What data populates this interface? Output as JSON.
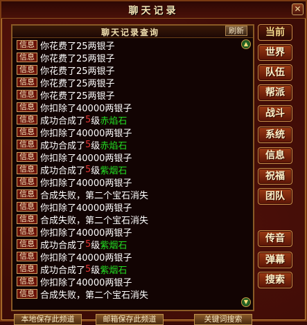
{
  "window": {
    "title": "聊天记录",
    "close_label": "✕"
  },
  "panel": {
    "title": "聊天记录查询",
    "refresh_label": "刷新"
  },
  "tag_label": "信息",
  "log": [
    {
      "segments": [
        {
          "t": "你花费了25两银子",
          "c": ""
        }
      ]
    },
    {
      "segments": [
        {
          "t": "你花费了25两银子",
          "c": ""
        }
      ]
    },
    {
      "segments": [
        {
          "t": "你花费了25两银子",
          "c": ""
        }
      ]
    },
    {
      "segments": [
        {
          "t": "你花费了25两银子",
          "c": ""
        }
      ]
    },
    {
      "segments": [
        {
          "t": "你花费了25两银子",
          "c": ""
        }
      ]
    },
    {
      "segments": [
        {
          "t": "你扣除了40000两银子",
          "c": ""
        }
      ]
    },
    {
      "segments": [
        {
          "t": "成功合成了",
          "c": ""
        },
        {
          "t": "5",
          "c": "lv"
        },
        {
          "t": "级",
          "c": ""
        },
        {
          "t": "赤焰石",
          "c": "item"
        }
      ]
    },
    {
      "segments": [
        {
          "t": "你扣除了40000两银子",
          "c": ""
        }
      ]
    },
    {
      "segments": [
        {
          "t": "成功合成了",
          "c": ""
        },
        {
          "t": "5",
          "c": "lv"
        },
        {
          "t": "级",
          "c": ""
        },
        {
          "t": "赤焰石",
          "c": "item"
        }
      ]
    },
    {
      "segments": [
        {
          "t": "你扣除了40000两银子",
          "c": ""
        }
      ]
    },
    {
      "segments": [
        {
          "t": "成功合成了",
          "c": ""
        },
        {
          "t": "5",
          "c": "lv"
        },
        {
          "t": "级",
          "c": ""
        },
        {
          "t": "紫烟石",
          "c": "item"
        }
      ]
    },
    {
      "segments": [
        {
          "t": "你扣除了40000两银子",
          "c": ""
        }
      ]
    },
    {
      "segments": [
        {
          "t": "合成失败，第二个宝石消失",
          "c": ""
        }
      ]
    },
    {
      "segments": [
        {
          "t": "你扣除了40000两银子",
          "c": ""
        }
      ]
    },
    {
      "segments": [
        {
          "t": "合成失败，第二个宝石消失",
          "c": ""
        }
      ]
    },
    {
      "segments": [
        {
          "t": "你扣除了40000两银子",
          "c": ""
        }
      ]
    },
    {
      "segments": [
        {
          "t": "成功合成了",
          "c": ""
        },
        {
          "t": "5",
          "c": "lv"
        },
        {
          "t": "级",
          "c": ""
        },
        {
          "t": "紫烟石",
          "c": "item"
        }
      ]
    },
    {
      "segments": [
        {
          "t": "你扣除了40000两银子",
          "c": ""
        }
      ]
    },
    {
      "segments": [
        {
          "t": "成功合成了",
          "c": ""
        },
        {
          "t": "5",
          "c": "lv"
        },
        {
          "t": "级",
          "c": ""
        },
        {
          "t": "紫烟石",
          "c": "item"
        }
      ]
    },
    {
      "segments": [
        {
          "t": "你扣除了40000两银子",
          "c": ""
        }
      ]
    },
    {
      "segments": [
        {
          "t": "合成失败，第二个宝石消失",
          "c": ""
        }
      ]
    }
  ],
  "channels": {
    "current": "当前",
    "world": "世界",
    "team": "队伍",
    "guild": "帮派",
    "battle": "战斗",
    "system": "系统",
    "info": "信息",
    "blessing": "祝福",
    "group": "团队",
    "voice": "传音",
    "danmaku": "弹幕",
    "search": "搜索"
  },
  "bottom": {
    "save_local": "本地保存此频道",
    "save_mail": "邮箱保存此频道",
    "keyword_search": "关键词搜索"
  },
  "colors": {
    "level_red": "#e23434",
    "item_green": "#22dd22",
    "text": "#ffffff"
  }
}
